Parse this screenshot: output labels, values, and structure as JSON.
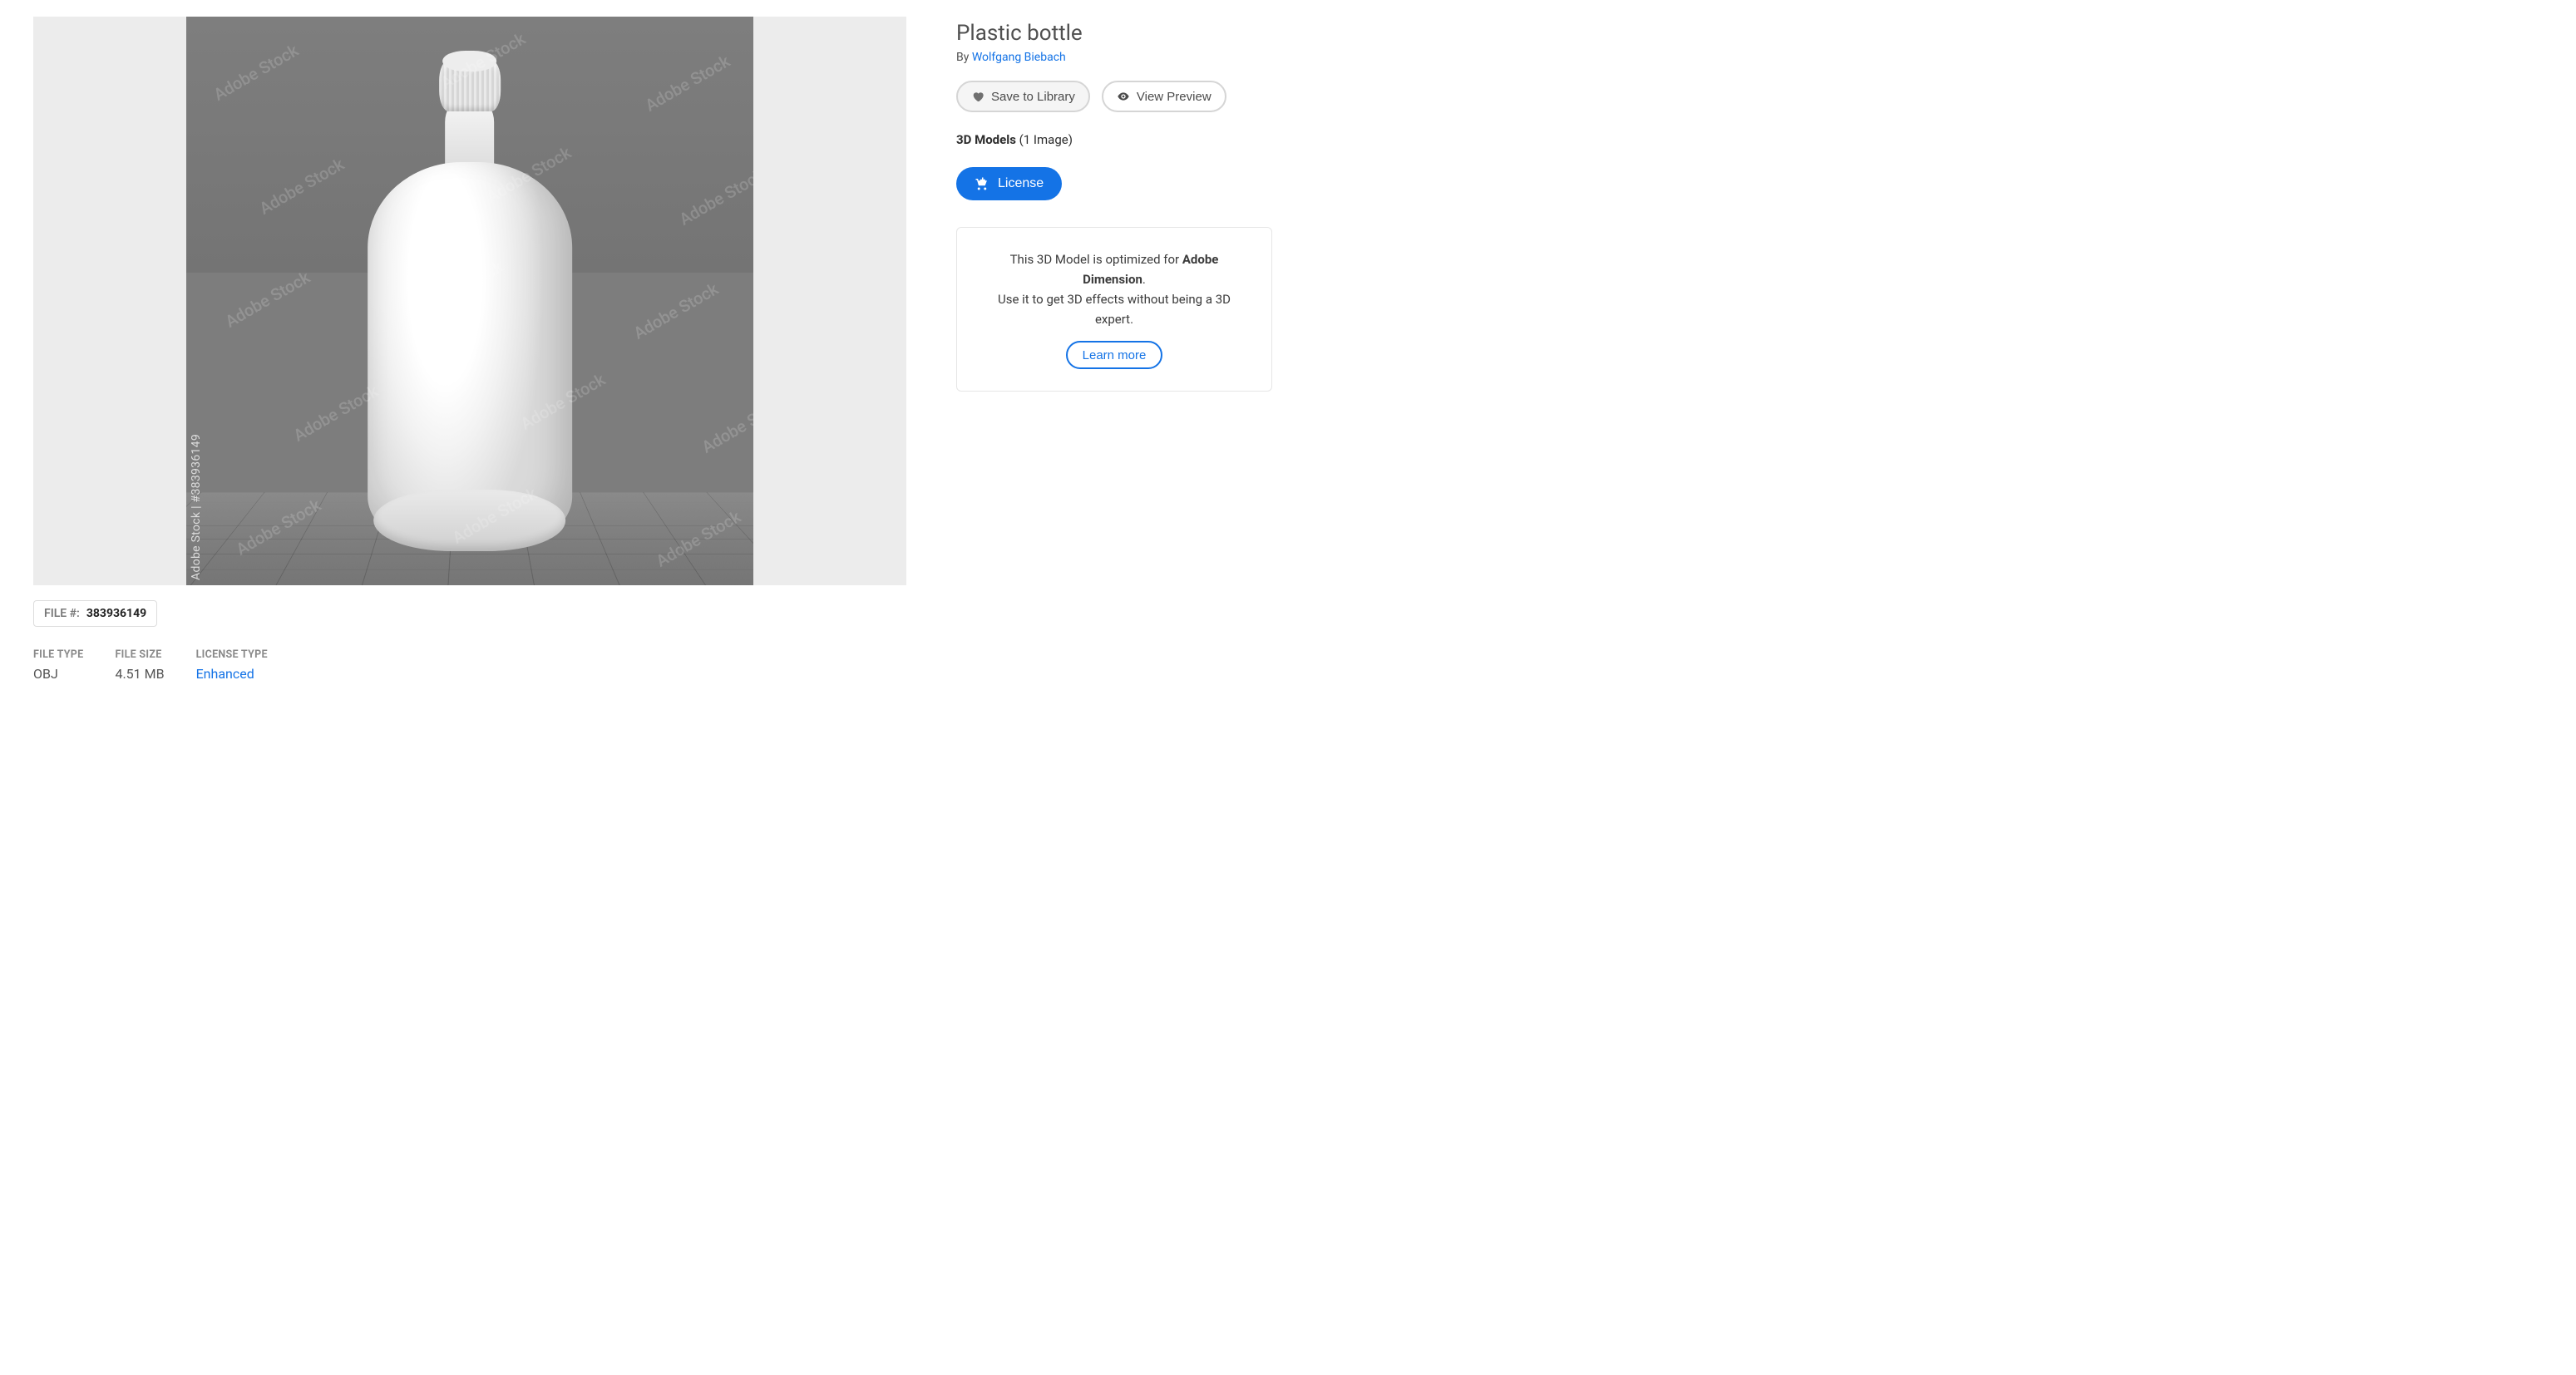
{
  "preview": {
    "watermark_name": "Adobe Stock",
    "side_text": "Adobe Stock | #383936149"
  },
  "details": {
    "title": "Plastic bottle",
    "by_prefix": "By ",
    "author": "Wolfgang Biebach"
  },
  "actions": {
    "save_to_library": "Save to Library",
    "view_preview": "View Preview",
    "license": "License"
  },
  "models_line": {
    "label": "3D Models",
    "count_text": "(1 Image)"
  },
  "info_card": {
    "line1_pre": "This 3D Model is optimized for ",
    "line1_strong": "Adobe Dimension",
    "line1_post": ".",
    "line2": "Use it to get 3D effects without being a 3D expert.",
    "learn_more": "Learn more"
  },
  "file_meta": {
    "file_number_label": "FILE #:",
    "file_number": "383936149",
    "file_type_label": "FILE TYPE",
    "file_type": "OBJ",
    "file_size_label": "FILE SIZE",
    "file_size": "4.51 MB",
    "license_type_label": "LICENSE TYPE",
    "license_type": "Enhanced"
  }
}
